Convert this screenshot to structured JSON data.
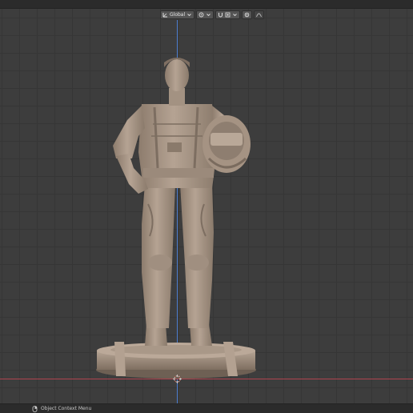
{
  "header": {
    "transform_orientation": "Global",
    "chevron_icon": "chevron-down-icon",
    "pivot_icon": "pivot-icon",
    "snap_icon": "magnet-icon",
    "proportional_icon": "proportional-edit-icon",
    "extra_icon": "falloff-icon"
  },
  "status_bar": {
    "mouse_icon": "mouse-icon",
    "hint": "Object Context Menu"
  },
  "viewport": {
    "object": "statue-figure",
    "colors": {
      "grid_bg": "#3d3d3d",
      "grid_line": "#363636",
      "axis_x": "#b0444f",
      "axis_y": "#4e7fd1",
      "model_base": "#a89686"
    }
  }
}
